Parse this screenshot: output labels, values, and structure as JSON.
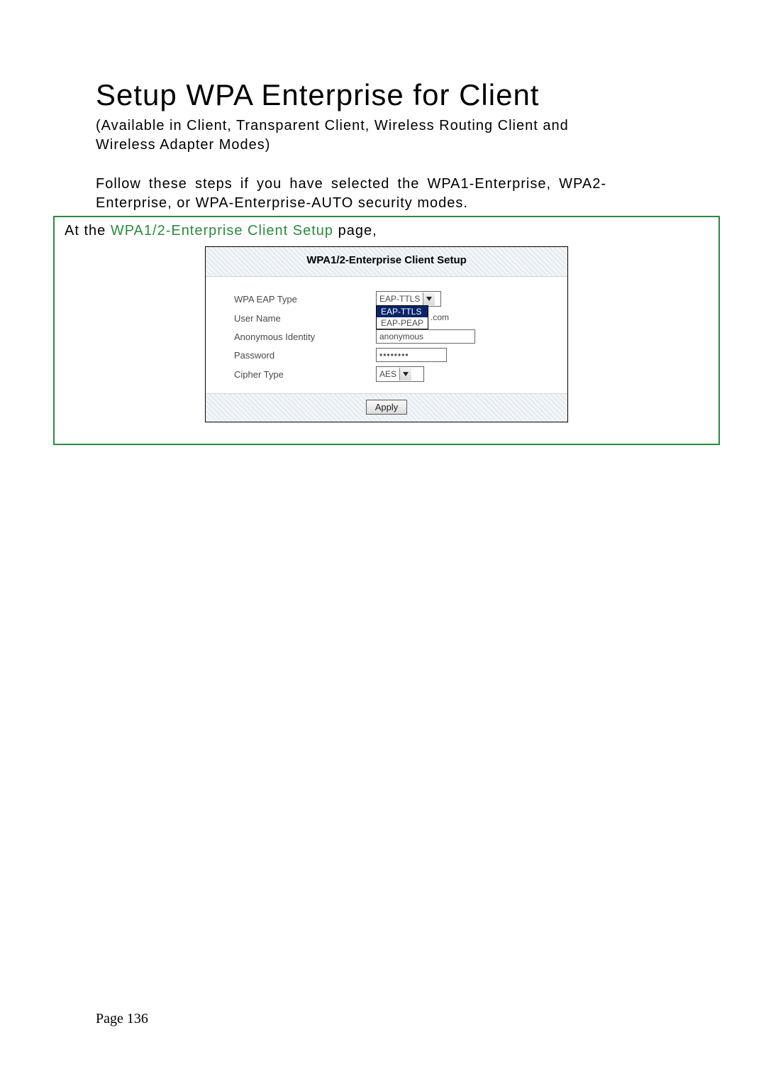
{
  "title": "Setup WPA Enterprise for Client",
  "subtitle": "(Available in Client, Transparent Client, Wireless Routing Client and Wireless Adapter Modes)",
  "intro": "Follow these steps if you have selected the WPA1-Enterprise, WPA2-Enterprise, or WPA-Enterprise-AUTO security modes.",
  "frame_lead_prefix": "At the ",
  "frame_lead_highlight": "WPA1/2-Enterprise Client Setup",
  "frame_lead_suffix": " page,",
  "shot": {
    "header": "WPA1/2-Enterprise Client Setup",
    "labels": {
      "eap_type": "WPA EAP Type",
      "user_name": "User Name",
      "anon_id": "Anonymous Identity",
      "password": "Password",
      "cipher": "Cipher Type"
    },
    "values": {
      "eap_type_selected": "EAP-TTLS",
      "eap_type_options": [
        "EAP-TTLS",
        "EAP-PEAP"
      ],
      "user_name_suffix": ".com",
      "anon_id": "anonymous",
      "password": "••••••••",
      "cipher_selected": "AES"
    },
    "apply": "Apply"
  },
  "page_number": "Page 136"
}
